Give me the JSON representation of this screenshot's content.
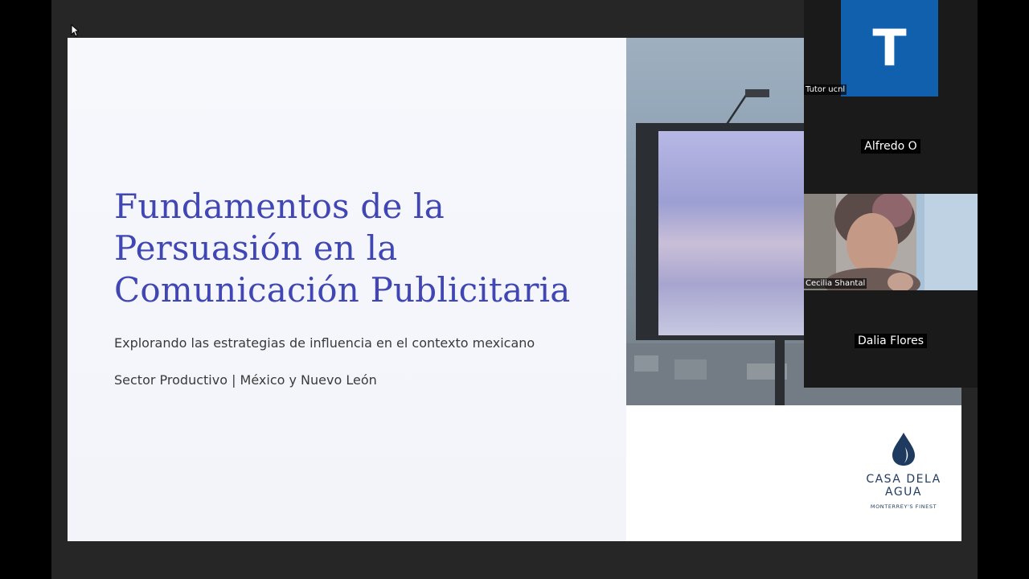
{
  "slide": {
    "title": "Fundamentos de la Persuasión en la Comunicación Publicitaria",
    "subtitle": "Explorando las estrategias de influencia en el contexto mexicano",
    "sector": "Sector Productivo | México y Nuevo León",
    "logo_name_line1": "CASA DELA",
    "logo_name_line2": "AGUA",
    "logo_tagline": "MONTERREY'S FINEST"
  },
  "participants": [
    {
      "name": "Tutor ucnl",
      "avatar_letter": "T",
      "avatar_color": "#1160ad"
    },
    {
      "name": "Alfredo O"
    },
    {
      "name": "Cecilia Shantal"
    },
    {
      "name": "Dalia Flores"
    }
  ],
  "colors": {
    "title": "#4046b4",
    "logo": "#1f3a5f",
    "background": "#262626"
  }
}
